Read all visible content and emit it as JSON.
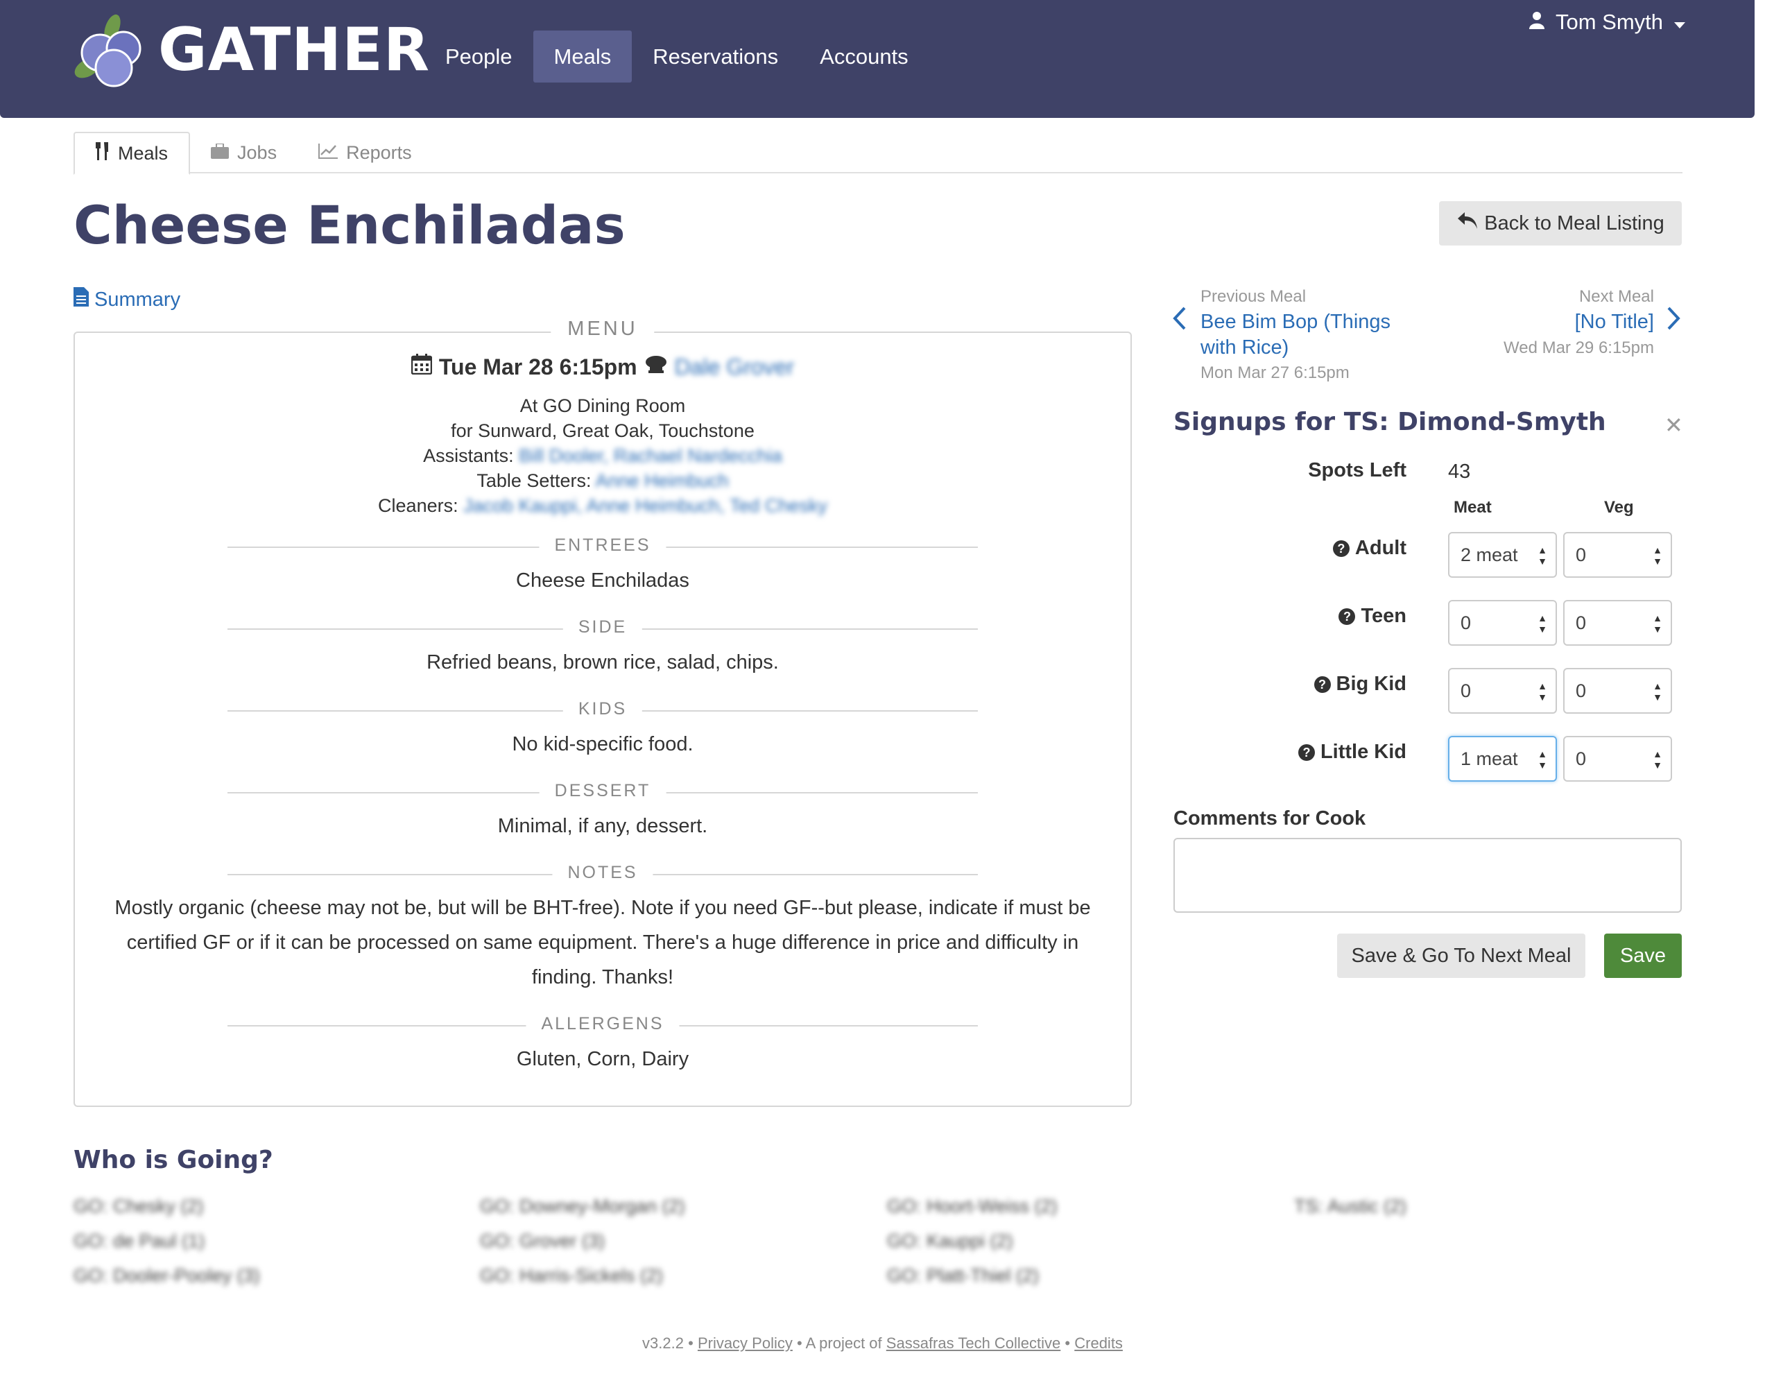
{
  "brand": {
    "name": "GATHER"
  },
  "nav": {
    "items": [
      "People",
      "Meals",
      "Reservations",
      "Accounts"
    ],
    "active": "Meals",
    "user": "Tom Smyth"
  },
  "subtabs": [
    "Meals",
    "Jobs",
    "Reports"
  ],
  "page": {
    "title": "Cheese Enchiladas",
    "back_label": "Back to Meal Listing",
    "summary_label": "Summary"
  },
  "menu": {
    "legend": "MENU",
    "when": "Tue Mar 28 6:15pm",
    "cook": "Dale Grover",
    "location": "At GO Dining Room",
    "for_line": "for Sunward, Great Oak, Touchstone",
    "assistants_label": "Assistants:",
    "assistants": "Bill Dooler, Rachael Nardecchia",
    "table_setters_label": "Table Setters:",
    "table_setters": "Anne Heimbuch",
    "cleaners_label": "Cleaners:",
    "cleaners": "Jacob Kauppi, Anne Heimbuch, Ted Chesky",
    "sections": [
      {
        "head": "ENTREES",
        "body": "Cheese Enchiladas"
      },
      {
        "head": "SIDE",
        "body": "Refried beans, brown rice, salad, chips."
      },
      {
        "head": "KIDS",
        "body": "No kid-specific food."
      },
      {
        "head": "DESSERT",
        "body": "Minimal, if any, dessert."
      },
      {
        "head": "NOTES",
        "body": "Mostly organic (cheese may not be, but will be BHT-free). Note if you need GF--but please, indicate if must be certified GF or if it can be processed on same equipment. There's a huge difference in price and difficulty in finding. Thanks!"
      },
      {
        "head": "ALLERGENS",
        "body": "Gluten, Corn, Dairy"
      }
    ]
  },
  "prev_meal": {
    "label": "Previous Meal",
    "title": "Bee Bim Bop (Things with Rice)",
    "title_line1": "Bee Bim Bop (Things",
    "title_line2": "with Rice)",
    "date": "Mon Mar 27 6:15pm"
  },
  "next_meal": {
    "label": "Next Meal",
    "title": "[No Title]",
    "date": "Wed Mar 29 6:15pm"
  },
  "signup": {
    "title": "Signups for TS: Dimond-Smyth",
    "spots_label": "Spots Left",
    "spots_left": "43",
    "col_meat": "Meat",
    "col_veg": "Veg",
    "rows": [
      {
        "label": "Adult",
        "meat": "2 meat",
        "veg": "0"
      },
      {
        "label": "Teen",
        "meat": "0",
        "veg": "0"
      },
      {
        "label": "Big Kid",
        "meat": "0",
        "veg": "0"
      },
      {
        "label": "Little Kid",
        "meat": "1 meat",
        "veg": "0"
      }
    ],
    "comments_label": "Comments for Cook",
    "comments_value": "",
    "save_next_label": "Save & Go To Next Meal",
    "save_label": "Save"
  },
  "who": {
    "title": "Who is Going?",
    "attendees": [
      "GO: Chesky (2)",
      "GO: Downey-Morgan (2)",
      "GO: Hoort-Weiss (2)",
      "TS: Austic (2)",
      "GO: de Paul (1)",
      "GO: Grover (3)",
      "GO: Kauppi (2)",
      "GO: Dooler-Pooley (3)",
      "GO: Harris-Sickels (2)",
      "GO: Platt-Thiel (2)"
    ]
  },
  "footer": {
    "version": "v3.2.2",
    "sep": "•",
    "privacy": "Privacy Policy",
    "project_prefix": "A project of",
    "collective": "Sassafras Tech Collective",
    "credits": "Credits"
  }
}
